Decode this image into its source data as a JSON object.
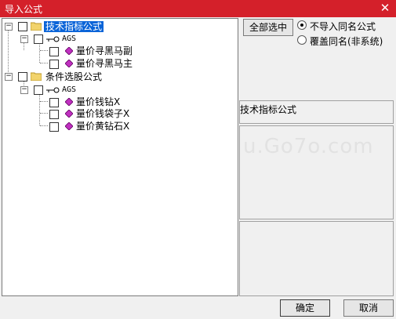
{
  "window": {
    "title": "导入公式",
    "close_glyph": "✕"
  },
  "tree": {
    "groups": [
      {
        "label": "技术指标公式",
        "sub": "AGS",
        "items": [
          "量价寻黑马副",
          "量价寻黑马主"
        ]
      },
      {
        "label": "条件选股公式",
        "sub": "AGS",
        "items": [
          "量价钱钻X",
          "量价钱袋子X",
          "量价黄钻石X"
        ]
      }
    ]
  },
  "buttons": {
    "select_all": "全部选中",
    "ok": "确定",
    "cancel": "取消"
  },
  "options": [
    {
      "label": "不导入同名公式",
      "selected": true
    },
    {
      "label": "覆盖同名(非系统)",
      "selected": false
    }
  ],
  "info_panel": {
    "title": "技术指标公式"
  },
  "watermark": "u.Go7o.com",
  "colors": {
    "titlebar": "#d4202a",
    "selection": "#0a64d8"
  }
}
